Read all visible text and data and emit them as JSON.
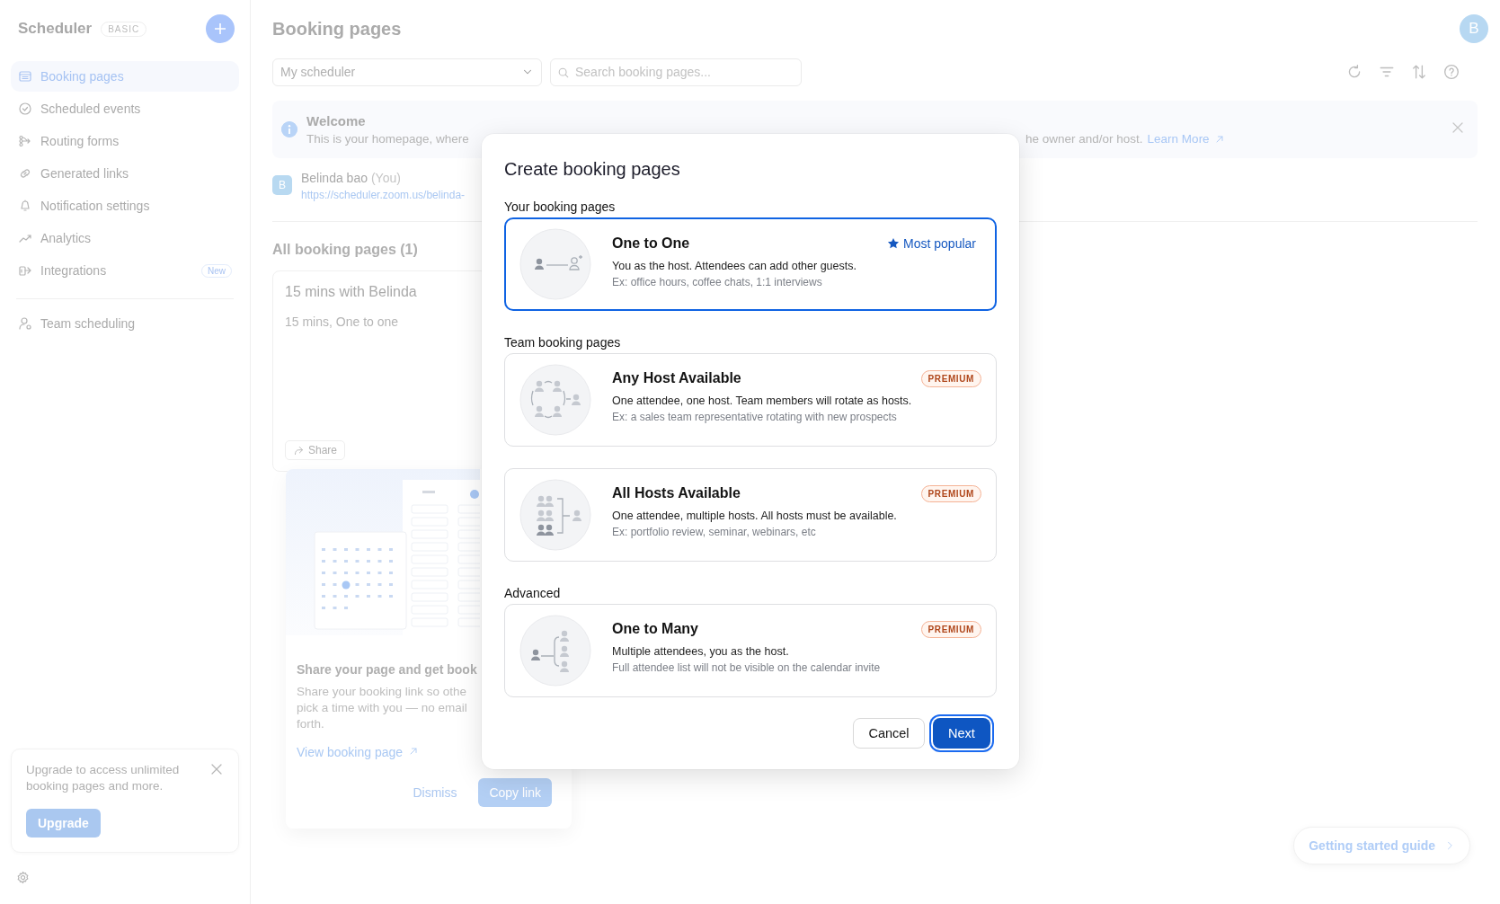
{
  "sidebar": {
    "title": "Scheduler",
    "plan_badge": "BASIC",
    "items": [
      {
        "label": "Booking pages",
        "selected": true
      },
      {
        "label": "Scheduled events",
        "selected": false
      },
      {
        "label": "Routing forms",
        "selected": false
      },
      {
        "label": "Generated links",
        "selected": false
      },
      {
        "label": "Notification settings",
        "selected": false
      },
      {
        "label": "Analytics",
        "selected": false
      },
      {
        "label": "Integrations",
        "selected": false,
        "badge": "New"
      }
    ],
    "team_item": {
      "label": "Team scheduling",
      "selected": false
    },
    "upgrade": {
      "text": "Upgrade to access unlimited booking pages and more.",
      "button": "Upgrade"
    }
  },
  "header": {
    "title": "Booking pages",
    "avatar": "B"
  },
  "toolbar": {
    "scheduler_select": "My scheduler",
    "search": {
      "placeholder": "Search booking pages..."
    }
  },
  "welcome": {
    "title": "Welcome",
    "text_start": "This is your homepage, where",
    "text_end": "he owner and/or host.",
    "link": "Learn More"
  },
  "owner": {
    "avatar": "B",
    "name": "Belinda bao",
    "tag": "(You)",
    "url": "https://scheduler.zoom.us/belinda-"
  },
  "list": {
    "heading": "All booking pages (1)",
    "cards": [
      {
        "title": "15 mins with Belinda",
        "subtitle": "15 mins, One to one",
        "share": "Share"
      }
    ]
  },
  "share_popover": {
    "title": "Share your page and get book",
    "text": "Share your booking link so othe\npick a time with you — no email\nforth.",
    "link": "View booking page",
    "dismiss": "Dismiss",
    "copy": "Copy link"
  },
  "guide_button": "Getting started guide",
  "modal": {
    "title": "Create booking pages",
    "sections": [
      {
        "label": "Your booking pages",
        "cards": [
          {
            "kind": "one_to_one",
            "title": "One to One",
            "description": "You as the host. Attendees can add other guests.",
            "example": "Ex: office hours, coffee chats, 1:1 interviews",
            "badge": {
              "kind": "popular",
              "text": "Most popular"
            },
            "selected": true
          }
        ]
      },
      {
        "label": "Team booking pages",
        "cards": [
          {
            "kind": "any_host",
            "title": "Any Host Available",
            "description": "One attendee, one host. Team members will rotate as hosts.",
            "example": "Ex: a sales team representative rotating with new prospects",
            "badge": {
              "kind": "premium",
              "text": "PREMIUM"
            },
            "selected": false
          },
          {
            "kind": "all_hosts",
            "title": "All Hosts Available",
            "description": "One attendee, multiple hosts. All hosts must be available.",
            "example": "Ex: portfolio review, seminar, webinars, etc",
            "badge": {
              "kind": "premium",
              "text": "PREMIUM"
            },
            "selected": false
          }
        ]
      },
      {
        "label": "Advanced",
        "cards": [
          {
            "kind": "one_to_many",
            "title": "One to Many",
            "description": "Multiple attendees, you as the host.",
            "example": "Full attendee list will not be visible on the calendar invite",
            "badge": {
              "kind": "premium",
              "text": "PREMIUM"
            },
            "selected": false
          }
        ]
      }
    ],
    "buttons": {
      "cancel": "Cancel",
      "next": "Next"
    }
  }
}
